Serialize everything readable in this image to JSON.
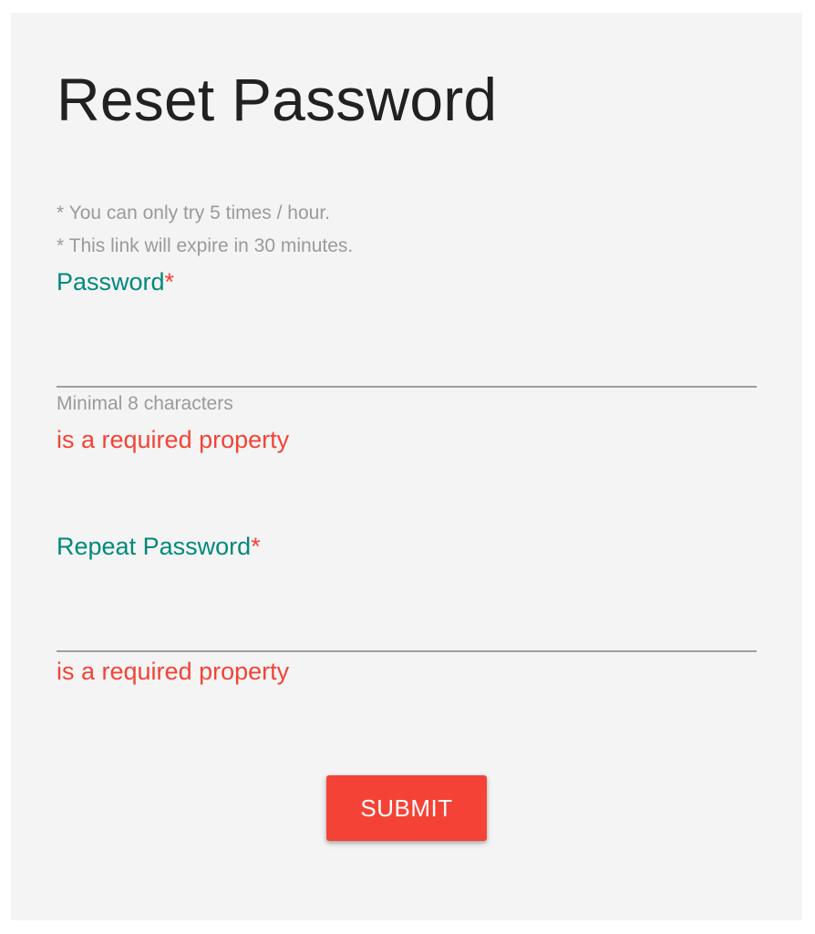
{
  "page": {
    "title": "Reset Password",
    "notices": [
      "* You can only try 5 times / hour.",
      "* This link will expire in 30 minutes."
    ]
  },
  "form": {
    "password": {
      "label": "Password",
      "required_marker": "*",
      "value": "",
      "helper": "Minimal 8 characters",
      "error": "is a required property"
    },
    "repeat_password": {
      "label": "Repeat Password",
      "required_marker": "*",
      "value": "",
      "error": "is a required property"
    },
    "submit_label": "SUBMIT"
  },
  "colors": {
    "accent_label": "#00897b",
    "error": "#f44336",
    "button_bg": "#f44336",
    "card_bg": "#f4f4f4"
  }
}
